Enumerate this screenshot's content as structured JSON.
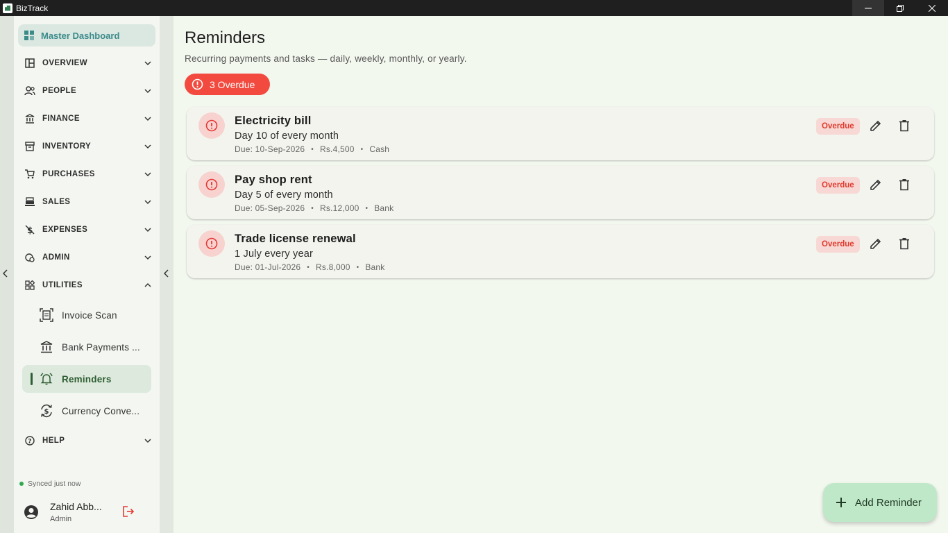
{
  "window": {
    "title": "BizTrack"
  },
  "sidebar": {
    "master": "Master Dashboard",
    "sections": [
      {
        "label": "OVERVIEW"
      },
      {
        "label": "PEOPLE"
      },
      {
        "label": "FINANCE"
      },
      {
        "label": "INVENTORY"
      },
      {
        "label": "PURCHASES"
      },
      {
        "label": "SALES"
      },
      {
        "label": "EXPENSES"
      },
      {
        "label": "ADMIN"
      },
      {
        "label": "UTILITIES"
      },
      {
        "label": "HELP"
      }
    ],
    "utilities": [
      {
        "label": "Invoice Scan"
      },
      {
        "label": "Bank Payments ..."
      },
      {
        "label": "Reminders"
      },
      {
        "label": "Currency Conve..."
      }
    ],
    "sync": "Synced just now",
    "user": {
      "name": "Zahid Abb...",
      "role": "Admin"
    }
  },
  "main": {
    "title": "Reminders",
    "subtitle": "Recurring payments and tasks — daily, weekly, monthly, or yearly.",
    "overdue_count": "3 Overdue",
    "reminders": [
      {
        "title": "Electricity bill",
        "schedule": "Day 10 of every month",
        "due": "Due: 10-Sep-2026",
        "amount": "Rs.4,500",
        "method": "Cash",
        "status": "Overdue"
      },
      {
        "title": "Pay shop rent",
        "schedule": "Day 5 of every month",
        "due": "Due: 05-Sep-2026",
        "amount": "Rs.12,000",
        "method": "Bank",
        "status": "Overdue"
      },
      {
        "title": "Trade license renewal",
        "schedule": "1 July every year",
        "due": "Due: 01-Jul-2026",
        "amount": "Rs.8,000",
        "method": "Bank",
        "status": "Overdue"
      }
    ],
    "add_button": "Add Reminder"
  },
  "colors": {
    "danger": "#f24a3e",
    "accent": "#2e5e33",
    "fab": "#bfe8c8"
  }
}
